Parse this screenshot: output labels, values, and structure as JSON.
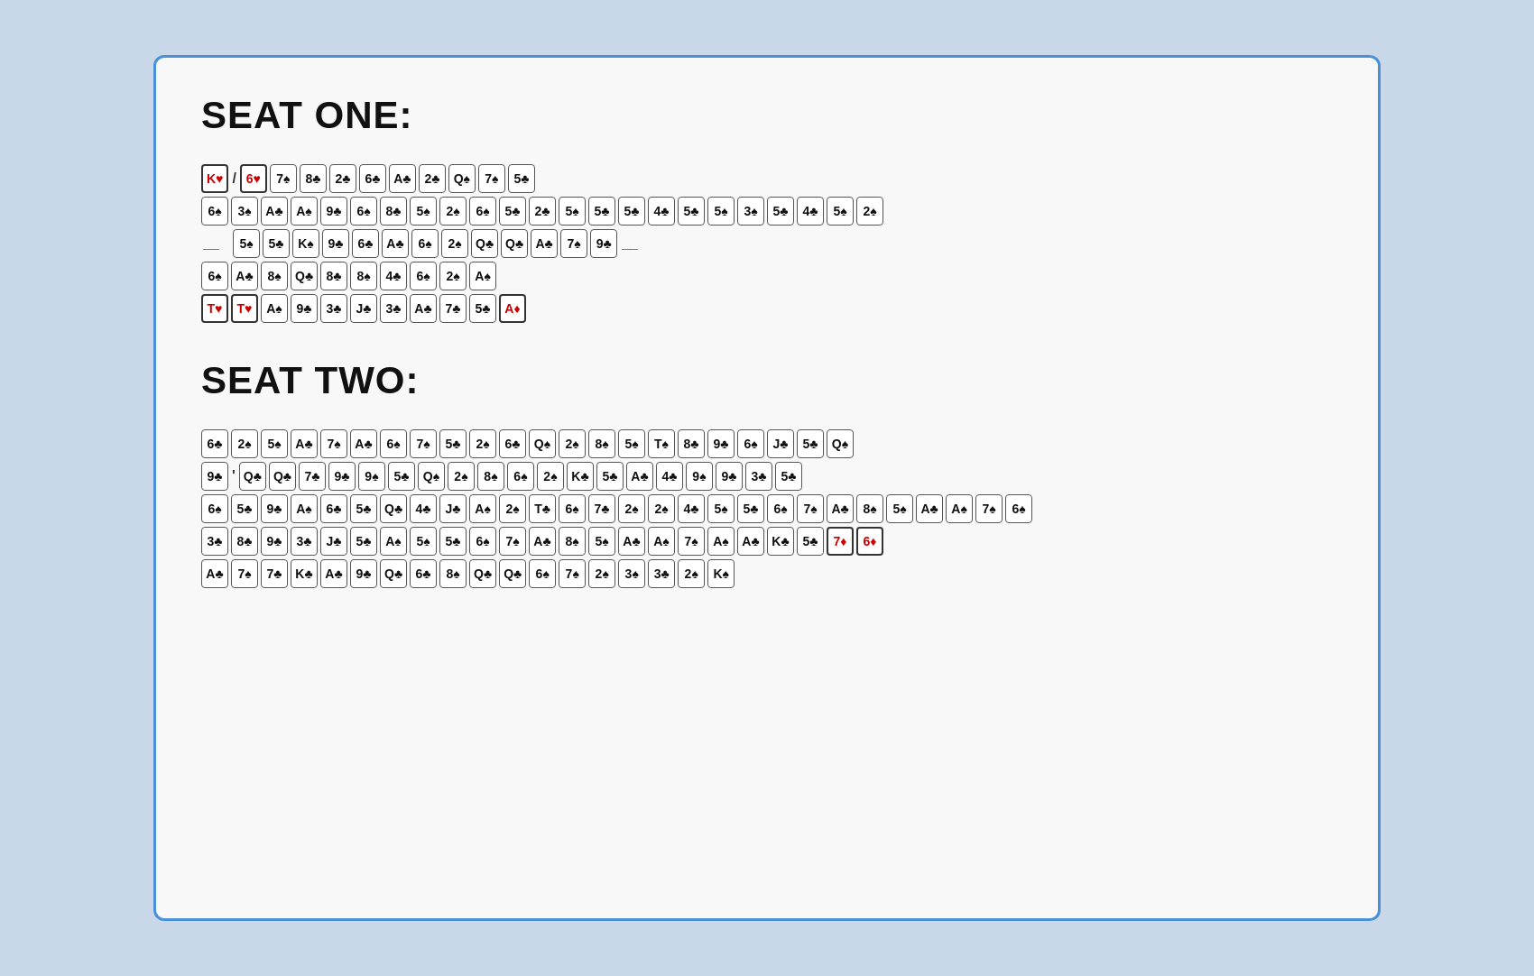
{
  "seats": [
    {
      "title": "SEAT ONE:",
      "rows": [
        {
          "type": "mixed",
          "items": [
            {
              "val": "K",
              "suit": "heart",
              "color": "red",
              "highlight": true
            },
            {
              "type": "sep",
              "text": "/"
            },
            {
              "val": "6",
              "suit": "heart",
              "color": "red",
              "highlight": true
            },
            {
              "val": "7",
              "suit": "spade",
              "color": "black"
            },
            {
              "val": "8",
              "suit": "club",
              "color": "black"
            },
            {
              "val": "2",
              "suit": "club",
              "color": "black"
            },
            {
              "val": "6",
              "suit": "club",
              "color": "black"
            },
            {
              "val": "A",
              "suit": "club",
              "color": "black"
            },
            {
              "val": "2",
              "suit": "club",
              "color": "black"
            },
            {
              "val": "Q",
              "suit": "spade",
              "color": "black"
            },
            {
              "val": "7",
              "suit": "spade",
              "color": "black"
            },
            {
              "val": "5",
              "suit": "club",
              "color": "black"
            }
          ]
        },
        {
          "type": "cards",
          "items": [
            {
              "val": "6",
              "suit": "spade"
            },
            {
              "val": "3",
              "suit": "spade"
            },
            {
              "val": "A",
              "suit": "club"
            },
            {
              "val": "A",
              "suit": "spade"
            },
            {
              "val": "9",
              "suit": "club"
            },
            {
              "val": "6",
              "suit": "spade"
            },
            {
              "val": "8",
              "suit": "club"
            },
            {
              "val": "5",
              "suit": "spade"
            },
            {
              "val": "2",
              "suit": "spade"
            },
            {
              "val": "6",
              "suit": "spade"
            },
            {
              "val": "5",
              "suit": "club"
            },
            {
              "val": "2",
              "suit": "club"
            },
            {
              "val": "5",
              "suit": "spade"
            },
            {
              "val": "5",
              "suit": "club"
            },
            {
              "val": "5",
              "suit": "club"
            },
            {
              "val": "4",
              "suit": "club"
            },
            {
              "val": "5",
              "suit": "club"
            },
            {
              "val": "5",
              "suit": "spade"
            },
            {
              "val": "3",
              "suit": "spade"
            },
            {
              "val": "5",
              "suit": "club"
            },
            {
              "val": "4",
              "suit": "club"
            },
            {
              "val": "5",
              "suit": "spade"
            },
            {
              "val": "2",
              "suit": "spade"
            }
          ]
        },
        {
          "type": "mixed",
          "items": [
            {
              "type": "blank",
              "text": "__"
            },
            {
              "val": "5",
              "suit": "spade"
            },
            {
              "val": "5",
              "suit": "club"
            },
            {
              "val": "K",
              "suit": "spade"
            },
            {
              "val": "9",
              "suit": "club"
            },
            {
              "val": "6",
              "suit": "club"
            },
            {
              "val": "A",
              "suit": "club"
            },
            {
              "val": "6",
              "suit": "spade"
            },
            {
              "val": "2",
              "suit": "spade"
            },
            {
              "val": "Q",
              "suit": "club"
            },
            {
              "val": "Q",
              "suit": "club"
            },
            {
              "val": "A",
              "suit": "club"
            },
            {
              "val": "7",
              "suit": "spade"
            },
            {
              "val": "9",
              "suit": "club"
            },
            {
              "type": "blank",
              "text": "__"
            }
          ]
        },
        {
          "type": "cards",
          "items": [
            {
              "val": "6",
              "suit": "spade"
            },
            {
              "val": "A",
              "suit": "club"
            },
            {
              "val": "8",
              "suit": "spade"
            },
            {
              "val": "Q",
              "suit": "club"
            },
            {
              "val": "8",
              "suit": "club"
            },
            {
              "val": "8",
              "suit": "spade"
            },
            {
              "val": "4",
              "suit": "club"
            },
            {
              "val": "6",
              "suit": "spade"
            },
            {
              "val": "2",
              "suit": "spade"
            },
            {
              "val": "A",
              "suit": "spade"
            }
          ]
        },
        {
          "type": "mixed",
          "items": [
            {
              "val": "T",
              "suit": "heart",
              "color": "red",
              "highlight": true
            },
            {
              "val": "T",
              "suit": "heart",
              "color": "red",
              "highlight": true
            },
            {
              "val": "A",
              "suit": "spade"
            },
            {
              "val": "9",
              "suit": "club"
            },
            {
              "val": "3",
              "suit": "club"
            },
            {
              "val": "J",
              "suit": "club"
            },
            {
              "val": "3",
              "suit": "club"
            },
            {
              "val": "A",
              "suit": "club"
            },
            {
              "val": "7",
              "suit": "club"
            },
            {
              "val": "5",
              "suit": "club"
            },
            {
              "val": "A",
              "suit": "diamond",
              "color": "red",
              "highlight": true
            }
          ]
        }
      ]
    },
    {
      "title": "SEAT TWO:",
      "rows": [
        {
          "type": "cards",
          "items": [
            {
              "val": "6",
              "suit": "club"
            },
            {
              "val": "2",
              "suit": "spade"
            },
            {
              "val": "5",
              "suit": "spade"
            },
            {
              "val": "A",
              "suit": "club"
            },
            {
              "val": "7",
              "suit": "spade"
            },
            {
              "val": "A",
              "suit": "club"
            },
            {
              "val": "6",
              "suit": "spade"
            },
            {
              "val": "7",
              "suit": "spade"
            },
            {
              "val": "5",
              "suit": "club"
            },
            {
              "val": "2",
              "suit": "spade"
            },
            {
              "val": "6",
              "suit": "club"
            },
            {
              "val": "Q",
              "suit": "spade"
            },
            {
              "val": "2",
              "suit": "spade"
            },
            {
              "val": "8",
              "suit": "spade"
            },
            {
              "val": "5",
              "suit": "spade"
            },
            {
              "val": "T",
              "suit": "spade"
            },
            {
              "val": "8",
              "suit": "club"
            },
            {
              "val": "9",
              "suit": "club"
            },
            {
              "val": "6",
              "suit": "spade"
            },
            {
              "val": "J",
              "suit": "club"
            },
            {
              "val": "5",
              "suit": "club"
            },
            {
              "val": "Q",
              "suit": "spade"
            }
          ]
        },
        {
          "type": "mixed",
          "items": [
            {
              "val": "9",
              "suit": "club"
            },
            {
              "type": "sep",
              "text": "'"
            },
            {
              "val": "Q",
              "suit": "club"
            },
            {
              "val": "Q",
              "suit": "club"
            },
            {
              "val": "7",
              "suit": "club"
            },
            {
              "val": "9",
              "suit": "club"
            },
            {
              "val": "9",
              "suit": "spade"
            },
            {
              "val": "5",
              "suit": "club"
            },
            {
              "val": "Q",
              "suit": "spade"
            },
            {
              "val": "2",
              "suit": "spade"
            },
            {
              "val": "8",
              "suit": "spade"
            },
            {
              "val": "6",
              "suit": "spade"
            },
            {
              "val": "2",
              "suit": "spade"
            },
            {
              "val": "K",
              "suit": "club"
            },
            {
              "val": "5",
              "suit": "club"
            },
            {
              "val": "A",
              "suit": "club"
            },
            {
              "val": "4",
              "suit": "club"
            },
            {
              "val": "9",
              "suit": "spade"
            },
            {
              "val": "9",
              "suit": "club"
            },
            {
              "val": "3",
              "suit": "club"
            },
            {
              "val": "5",
              "suit": "club"
            }
          ]
        },
        {
          "type": "cards",
          "items": [
            {
              "val": "6",
              "suit": "spade"
            },
            {
              "val": "5",
              "suit": "club"
            },
            {
              "val": "9",
              "suit": "club"
            },
            {
              "val": "A",
              "suit": "spade"
            },
            {
              "val": "6",
              "suit": "club"
            },
            {
              "val": "5",
              "suit": "club"
            },
            {
              "val": "Q",
              "suit": "club"
            },
            {
              "val": "4",
              "suit": "club"
            },
            {
              "val": "J",
              "suit": "club"
            },
            {
              "val": "A",
              "suit": "spade"
            },
            {
              "val": "2",
              "suit": "spade"
            },
            {
              "val": "T",
              "suit": "club"
            },
            {
              "val": "6",
              "suit": "spade"
            },
            {
              "val": "7",
              "suit": "club"
            },
            {
              "val": "2",
              "suit": "spade"
            },
            {
              "val": "2",
              "suit": "spade"
            },
            {
              "val": "4",
              "suit": "club"
            },
            {
              "val": "5",
              "suit": "spade"
            },
            {
              "val": "5",
              "suit": "club"
            },
            {
              "val": "6",
              "suit": "spade"
            },
            {
              "val": "7",
              "suit": "spade"
            },
            {
              "val": "A",
              "suit": "club"
            },
            {
              "val": "8",
              "suit": "spade"
            },
            {
              "val": "5",
              "suit": "spade"
            },
            {
              "val": "A",
              "suit": "club"
            },
            {
              "val": "A",
              "suit": "spade"
            },
            {
              "val": "7",
              "suit": "spade"
            },
            {
              "val": "6",
              "suit": "spade"
            }
          ]
        },
        {
          "type": "mixed",
          "items": [
            {
              "val": "3",
              "suit": "club"
            },
            {
              "val": "8",
              "suit": "club"
            },
            {
              "val": "9",
              "suit": "club"
            },
            {
              "val": "3",
              "suit": "club"
            },
            {
              "val": "J",
              "suit": "club"
            },
            {
              "val": "5",
              "suit": "club"
            },
            {
              "val": "A",
              "suit": "spade"
            },
            {
              "val": "5",
              "suit": "spade"
            },
            {
              "val": "5",
              "suit": "club"
            },
            {
              "val": "6",
              "suit": "spade"
            },
            {
              "val": "7",
              "suit": "spade"
            },
            {
              "val": "A",
              "suit": "club"
            },
            {
              "val": "8",
              "suit": "spade"
            },
            {
              "val": "5",
              "suit": "spade"
            },
            {
              "val": "A",
              "suit": "club"
            },
            {
              "val": "A",
              "suit": "spade"
            },
            {
              "val": "7",
              "suit": "spade"
            },
            {
              "val": "A",
              "suit": "spade"
            },
            {
              "val": "A",
              "suit": "club"
            },
            {
              "val": "K",
              "suit": "club"
            },
            {
              "val": "5",
              "suit": "club"
            },
            {
              "val": "7",
              "suit": "diamond",
              "color": "red",
              "highlight": true
            },
            {
              "val": "6",
              "suit": "diamond",
              "color": "red",
              "highlight": true
            }
          ]
        },
        {
          "type": "cards",
          "items": [
            {
              "val": "A",
              "suit": "club"
            },
            {
              "val": "7",
              "suit": "spade"
            },
            {
              "val": "7",
              "suit": "club"
            },
            {
              "val": "K",
              "suit": "club"
            },
            {
              "val": "A",
              "suit": "club"
            },
            {
              "val": "9",
              "suit": "club"
            },
            {
              "val": "Q",
              "suit": "club"
            },
            {
              "val": "6",
              "suit": "club"
            },
            {
              "val": "8",
              "suit": "spade"
            },
            {
              "val": "Q",
              "suit": "club"
            },
            {
              "val": "Q",
              "suit": "club"
            },
            {
              "val": "6",
              "suit": "spade"
            },
            {
              "val": "7",
              "suit": "spade"
            },
            {
              "val": "2",
              "suit": "spade"
            },
            {
              "val": "3",
              "suit": "spade"
            },
            {
              "val": "3",
              "suit": "club"
            },
            {
              "val": "2",
              "suit": "spade"
            },
            {
              "val": "K",
              "suit": "spade"
            }
          ]
        }
      ]
    }
  ]
}
